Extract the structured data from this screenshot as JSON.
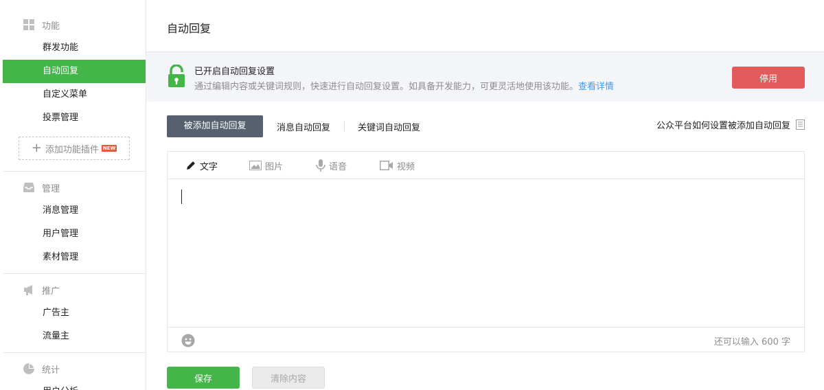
{
  "sidebar": {
    "sections": [
      {
        "label": "功能",
        "icon": "grid-icon",
        "items": [
          "群发功能",
          "自动回复",
          "自定义菜单",
          "投票管理"
        ]
      },
      {
        "label": "管理",
        "icon": "inbox-icon",
        "items": [
          "消息管理",
          "用户管理",
          "素材管理"
        ]
      },
      {
        "label": "推广",
        "icon": "megaphone-icon",
        "items": [
          "广告主",
          "流量主"
        ]
      },
      {
        "label": "统计",
        "icon": "pie-chart-icon",
        "items": [
          "用户分析"
        ]
      }
    ],
    "active_item": "自动回复",
    "add_plugin_label": "添加功能插件",
    "new_badge": "NEW"
  },
  "main": {
    "title": "自动回复",
    "notice": {
      "title": "已开启自动回复设置",
      "desc": "通过编辑内容或关键词规则，快速进行自动回复设置。如具备开发能力，可更灵活地使用该功能。",
      "link": "查看详情",
      "stop_button": "停用"
    },
    "tabs": [
      "被添加自动回复",
      "消息自动回复",
      "关键词自动回复"
    ],
    "active_tab": "被添加自动回复",
    "help_link": "公众平台如何设置被添加自动回复",
    "editor": {
      "tools": [
        "文字",
        "图片",
        "语音",
        "视频"
      ],
      "active_tool": "文字",
      "remaining": "还可以输入 600 字"
    },
    "save_button": "保存",
    "clear_button": "清除内容"
  },
  "colors": {
    "accent_green": "#44b549",
    "danger_red": "#e35a5a",
    "tab_dark": "#56606e",
    "link_blue": "#459ae9"
  }
}
